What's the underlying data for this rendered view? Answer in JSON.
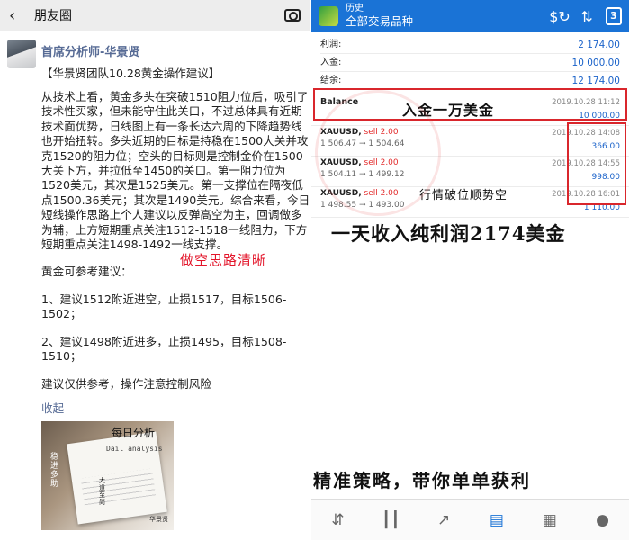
{
  "wechat": {
    "header_title": "朋友圈",
    "author": "首席分析师-华景贤",
    "post_title": "【华景贤团队10.28黄金操作建议】",
    "analysis": "从技术上看，黄金多头在突破1510阻力位后，吸引了技术性买家，但未能守住此关口，不过总体具有近期技术面优势，日线图上有一条长达六周的下降趋势线也开始扭转。多头近期的目标是持稳在1500大关并攻克1520的阻力位；空头的目标则是控制金价在1500大关下方，并拉低至1450的关口。第一阻力位为1520美元，其次是1525美元。第一支撑位在隔夜低点1500.36美元；其次是1490美元。综合来看，今日短线操作思路上个人建议以反弹高空为主，回调做多为辅，上方短期重点关注1512-1518一线阻力，下方短期重点关注1498-1492一线支撑。",
    "tips_intro": "黄金可参考建议：",
    "tip1": "1、建议1512附近进空，止损1517，目标1506-1502；",
    "tip2": "2、建议1498附近进多，止损1495，目标1508-1510；",
    "disclaimer": "建议仅供参考，操作注意控制风险",
    "collapse": "收起",
    "handwriting": "做空思路清晰",
    "thumbnail": {
      "title": "每日分析",
      "subtitle": "Dail analysis",
      "vertical_text": "稳进多助",
      "vertical_text2": "大道至简",
      "sign": "华景贤"
    }
  },
  "mt4": {
    "header_small": "历史",
    "header_title": "全部交易品种",
    "calendar_badge": "3",
    "summary": [
      {
        "label": "利润:",
        "value": "2 174.00"
      },
      {
        "label": "入金:",
        "value": "10 000.00"
      },
      {
        "label": "结余:",
        "value": "12 174.00"
      }
    ],
    "balance": {
      "label": "Balance",
      "time": "2019.10.28 11:12",
      "amount": "10 000.00"
    },
    "deals": [
      {
        "symbol": "XAUUSD,",
        "side": "sell 2.00",
        "prices": "1 506.47 → 1 504.64",
        "time": "2019.10.28 14:08",
        "profit": "366.00"
      },
      {
        "symbol": "XAUUSD,",
        "side": "sell 2.00",
        "prices": "1 504.11 → 1 499.12",
        "time": "2019.10.28 14:55",
        "profit": "998.00"
      },
      {
        "symbol": "XAUUSD,",
        "side": "sell 2.00",
        "prices": "1 498.55 → 1 493.00",
        "time": "2019.10.28 16:01",
        "profit": "1 110.00"
      }
    ],
    "overlay_deposit": "入金一万美金",
    "overlay_break": "行情破位顺势空",
    "overlay_profit": "一天收入纯利润2174美金",
    "overlay_slogan": "精准策略，带你单单获利",
    "nav_icons": [
      "quotes-icon",
      "chart-icon",
      "trade-icon",
      "history-icon",
      "news-icon",
      "chat-icon"
    ]
  },
  "colors": {
    "mt4_header": "#1a73d6",
    "link_blue": "#576b95",
    "profit_blue": "#1a62c9",
    "sell_red": "#e22a2a",
    "annotation_red": "#d9262c"
  }
}
